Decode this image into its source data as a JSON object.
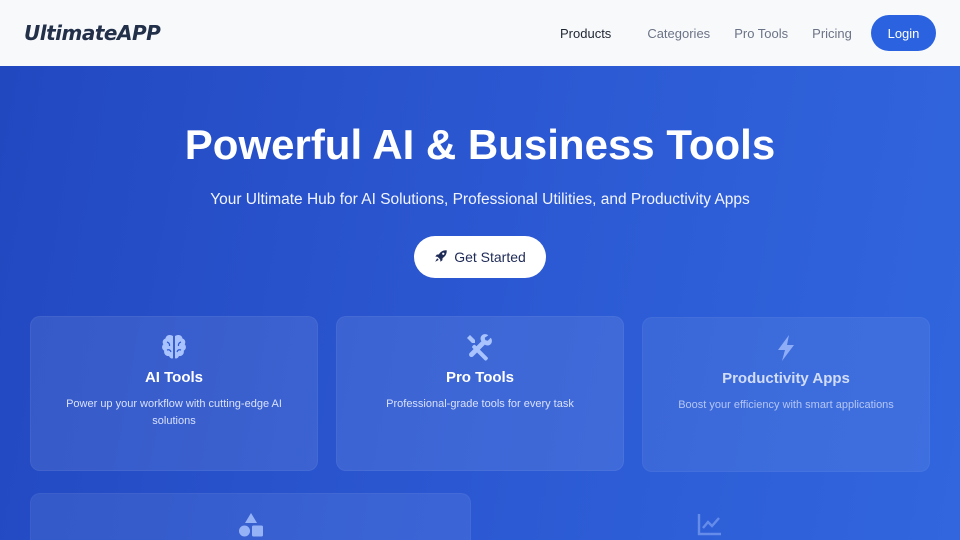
{
  "brand": {
    "logo": "UltimateAPP"
  },
  "nav": {
    "items": [
      {
        "label": "Products",
        "active": true
      },
      {
        "label": "Categories",
        "active": false
      },
      {
        "label": "Pro Tools",
        "active": false
      },
      {
        "label": "Pricing",
        "active": false
      }
    ],
    "login_label": "Login"
  },
  "hero": {
    "title": "Powerful AI & Business Tools",
    "subtitle": "Your Ultimate Hub for AI Solutions, Professional Utilities, and Productivity Apps",
    "cta_label": "Get Started",
    "cta_icon": "rocket-icon"
  },
  "cards": [
    {
      "icon": "brain-icon",
      "title": "AI Tools",
      "description": "Power up your workflow with cutting-edge AI solutions"
    },
    {
      "icon": "tools-icon",
      "title": "Pro Tools",
      "description": "Professional-grade tools for every task"
    },
    {
      "icon": "bolt-icon",
      "title": "Productivity Apps",
      "description": "Boost your efficiency with smart applications"
    },
    {
      "icon": "shapes-icon"
    },
    {
      "icon": "chart-line-icon"
    }
  ],
  "colors": {
    "nav_bg": "#f8f9fb",
    "hero_bg": "#2a55cf",
    "accent": "#2a62e0",
    "icon_tint": "#a9c3ff"
  }
}
